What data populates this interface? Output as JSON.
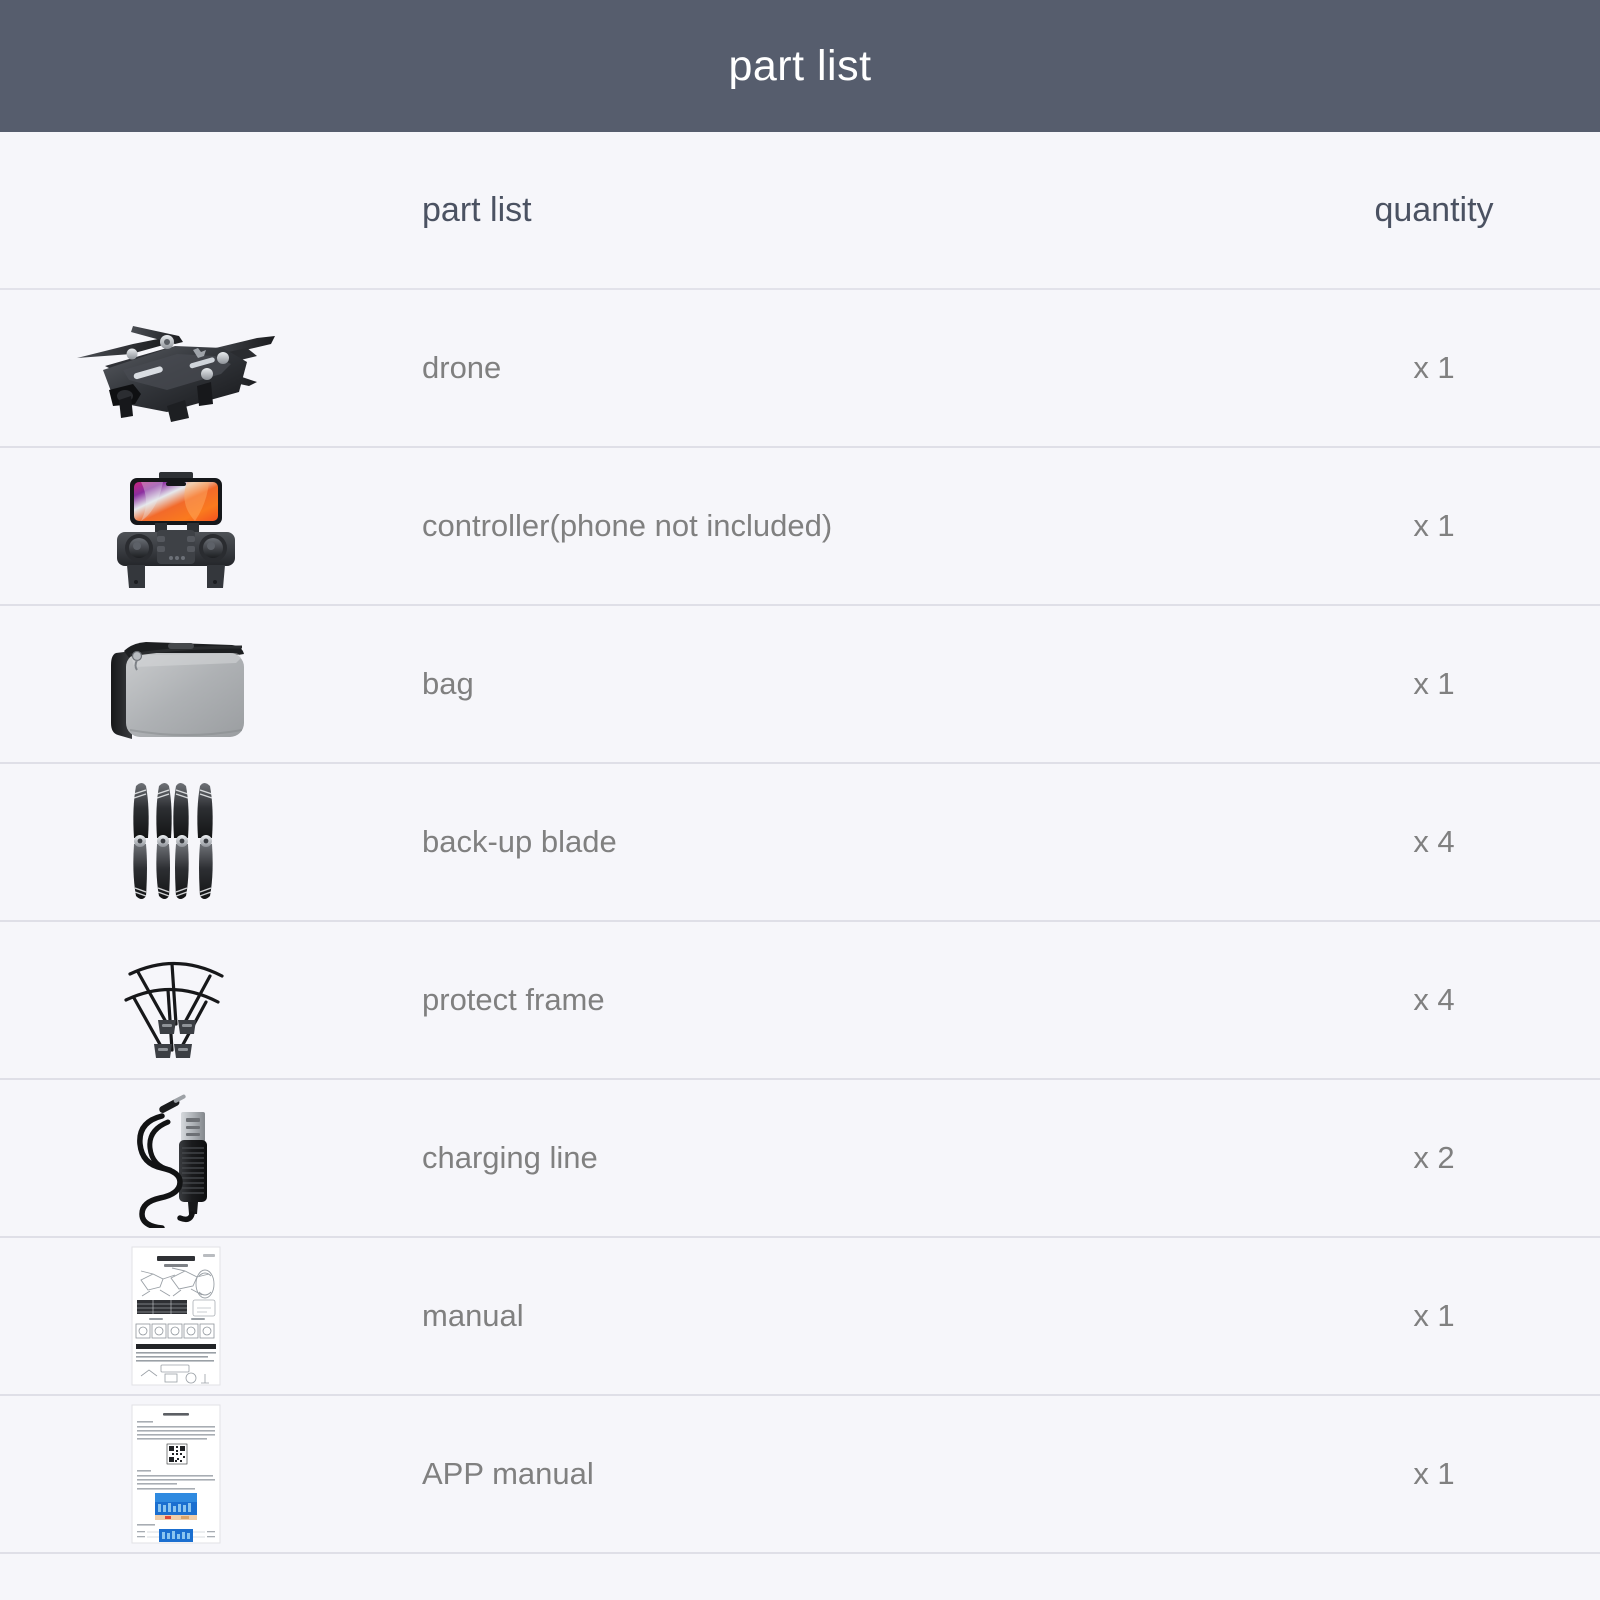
{
  "banner": {
    "title": "part list"
  },
  "table": {
    "columns": {
      "name": "part list",
      "quantity": "quantity"
    },
    "rows": [
      {
        "image": "drone-photo",
        "name": "drone",
        "quantity": "x 1"
      },
      {
        "image": "controller-photo",
        "name": "controller(phone not included)",
        "quantity": "x 1"
      },
      {
        "image": "bag-photo",
        "name": "bag",
        "quantity": "x 1"
      },
      {
        "image": "backup-blade-photo",
        "name": "back-up blade",
        "quantity": "x 4"
      },
      {
        "image": "protect-frame-photo",
        "name": "protect frame",
        "quantity": "x 4"
      },
      {
        "image": "charging-line-photo",
        "name": "charging line",
        "quantity": "x 2"
      },
      {
        "image": "manual-photo",
        "name": "manual",
        "quantity": "x 1"
      },
      {
        "image": "app-manual-photo",
        "name": "APP manual",
        "quantity": "x 1"
      }
    ]
  },
  "colors": {
    "banner_background": "#565d6d",
    "banner_text": "#ffffff",
    "page_background": "#f6f6fa",
    "header_text": "#4b5262",
    "row_text": "#808080",
    "divider": "#dfdfe7"
  }
}
